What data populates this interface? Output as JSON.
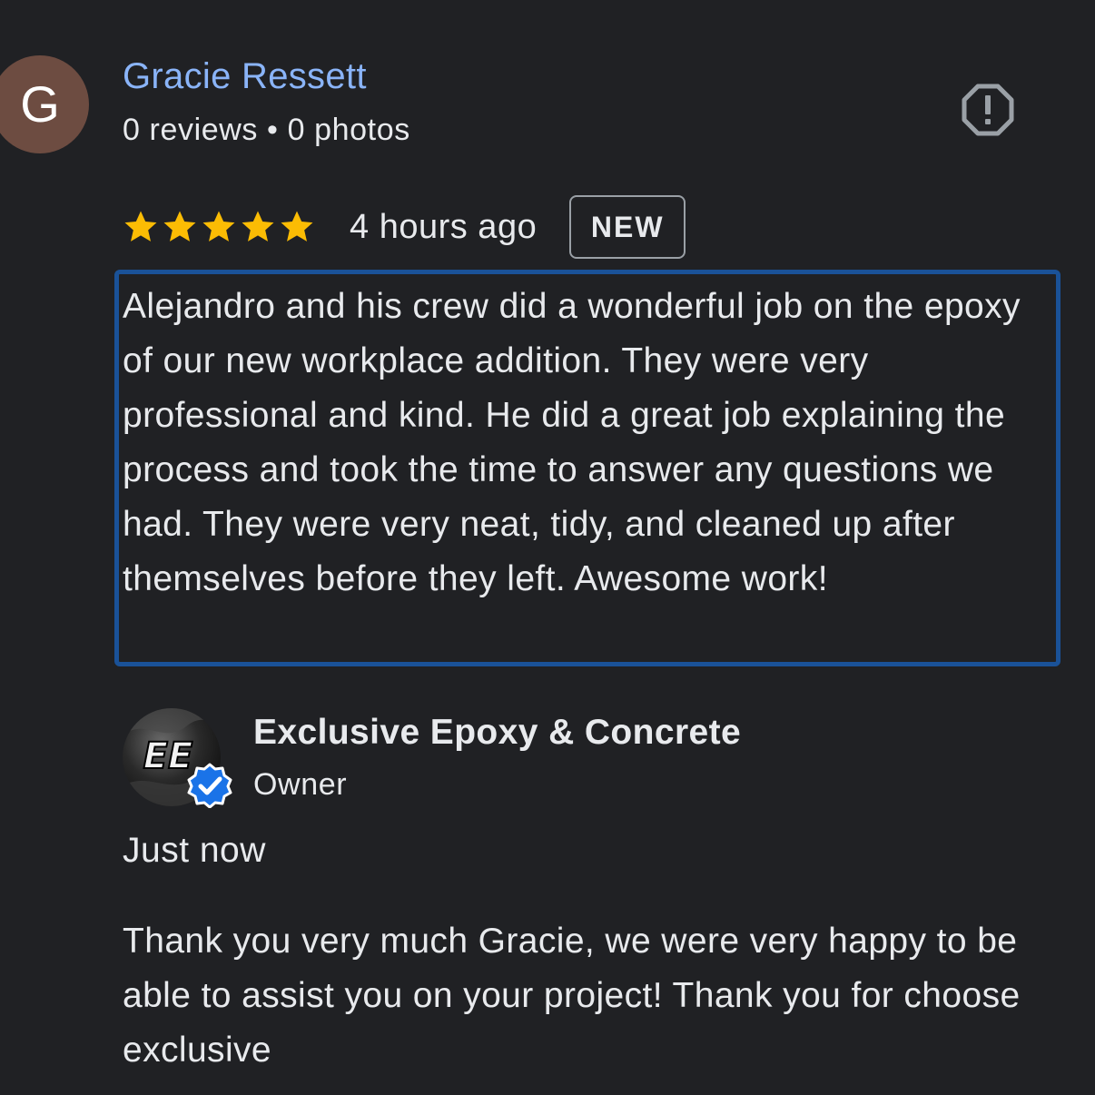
{
  "reviewer": {
    "initial": "G",
    "avatar_color": "#6d4c41",
    "name": "Gracie Ressett",
    "meta": "0 reviews • 0 photos"
  },
  "report": {
    "icon": "report-icon"
  },
  "rating": {
    "stars": 5,
    "max": 5,
    "star_color": "#fbbc04",
    "time_ago": "4 hours ago",
    "badge": "NEW"
  },
  "review": {
    "text": "Alejandro and his crew did a wonderful job on the epoxy of our new workplace addition. They were very professional and kind. He did a great job explaining the process and took the time to answer any questions we had. They were very neat, tidy, and cleaned up after themselves before they left. Awesome work!",
    "highlight_color": "#1a5298"
  },
  "owner_reply": {
    "logo": "EE",
    "name": "Exclusive Epoxy & Concrete",
    "role": "Owner",
    "verified_color": "#1a73e8",
    "time": "Just now",
    "text": "Thank you very much Gracie, we were very happy to be able to assist you on your project! Thank you for choose exclusive"
  },
  "colors": {
    "background": "#202124",
    "name_link": "#8ab4f8",
    "text": "#e8eaed"
  }
}
